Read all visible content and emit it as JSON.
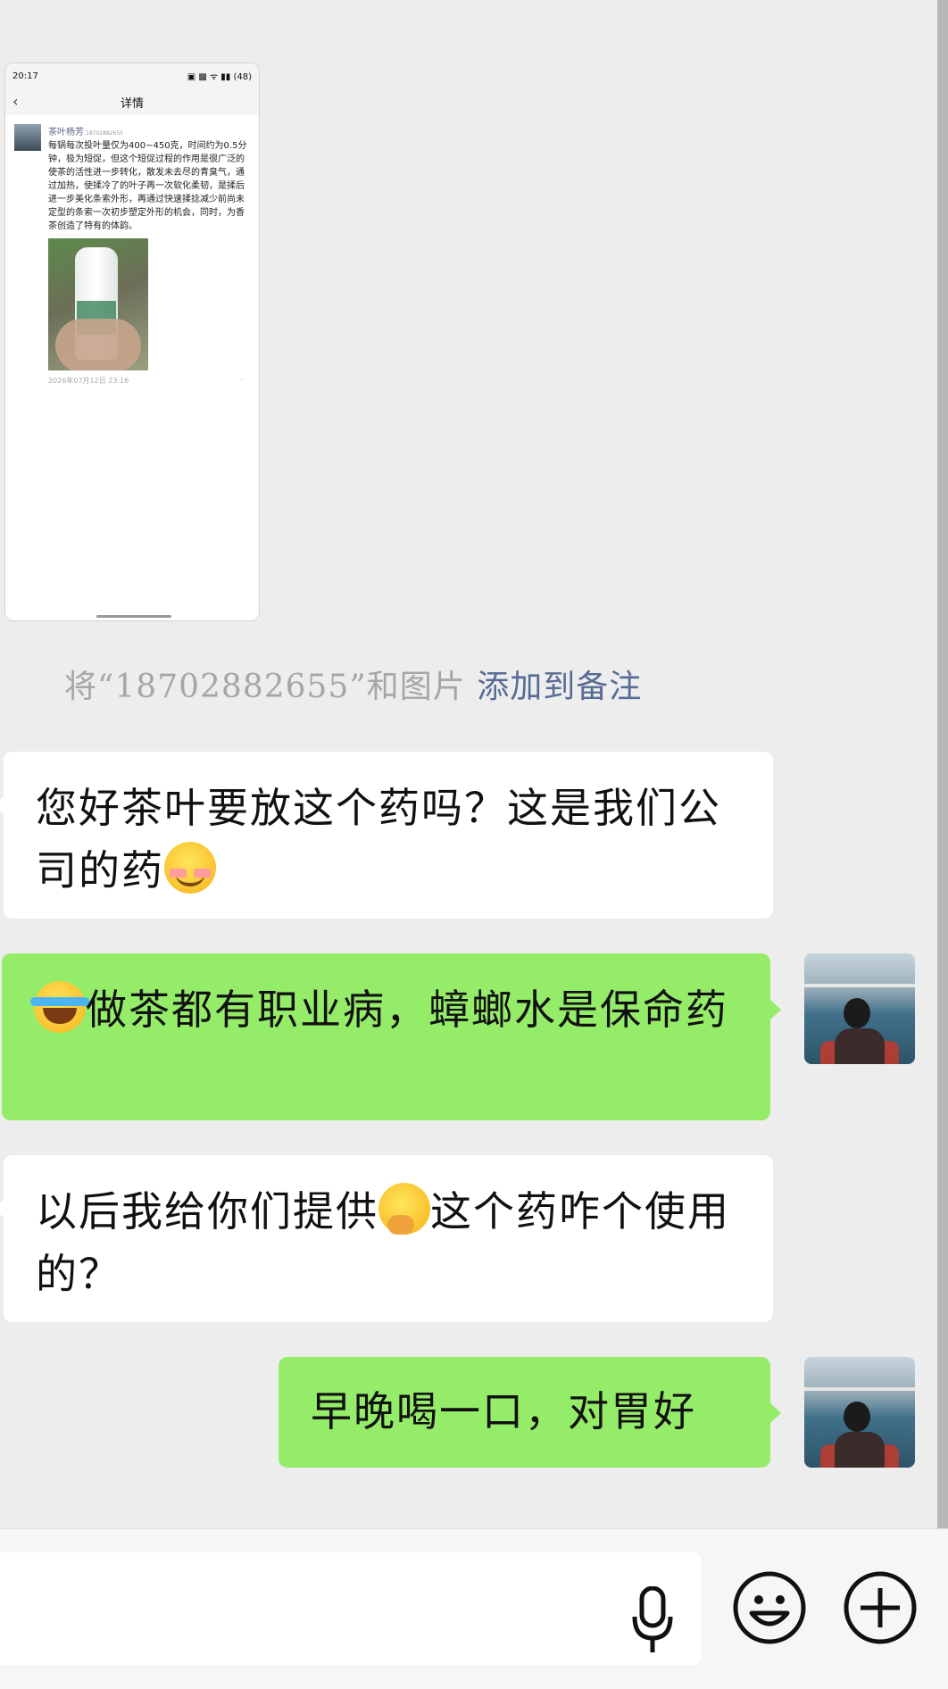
{
  "screenshot_message": {
    "status_time": "20:17",
    "status_icons": "▣ ▩ ᯤ ▮▮ (48)",
    "nav_title": "详情",
    "post_author": "茶叶杨芳",
    "post_author_sub": "18702882655",
    "post_text": "每锅每次投叶量仅为400~450克，时间约为0.5分钟，极为短促，但这个短促过程的作用是很广泛的使茶的活性进一步转化，散发未去尽的青臭气，通过加热，使揉冷了的叶子再一次软化柔韧，是揉后进一步美化条索外形，再通过快速揉捻减少前尚未定型的条索一次初步塑定外形的机会，同时，为香茶创造了特有的体韵。",
    "post_time": "2026年07月12日 23:16",
    "post_more": "··"
  },
  "system_note": {
    "prefix": "将“18702882655”和图片",
    "link": "添加到备注"
  },
  "messages": [
    {
      "side": "in",
      "text": "您好茶叶要放这个药吗？这是我们公司的药",
      "emoji": "smiling-face"
    },
    {
      "side": "out",
      "emoji": "loudly-crying",
      "text": "做茶都有职业病，蟑螂水是保命药"
    },
    {
      "side": "in",
      "text_before": "以后我给你们提供",
      "emoji": "thinking-face",
      "text_after": "这个药咋个使用的？"
    },
    {
      "side": "out",
      "text": "早晚喝一口，对胃好"
    }
  ],
  "colors": {
    "background": "#ededed",
    "incoming_bubble": "#ffffff",
    "outgoing_bubble": "#95ec69",
    "link": "#576b95"
  },
  "input_bar": {
    "icons": [
      "microphone-icon",
      "emoji-icon",
      "plus-icon"
    ]
  }
}
